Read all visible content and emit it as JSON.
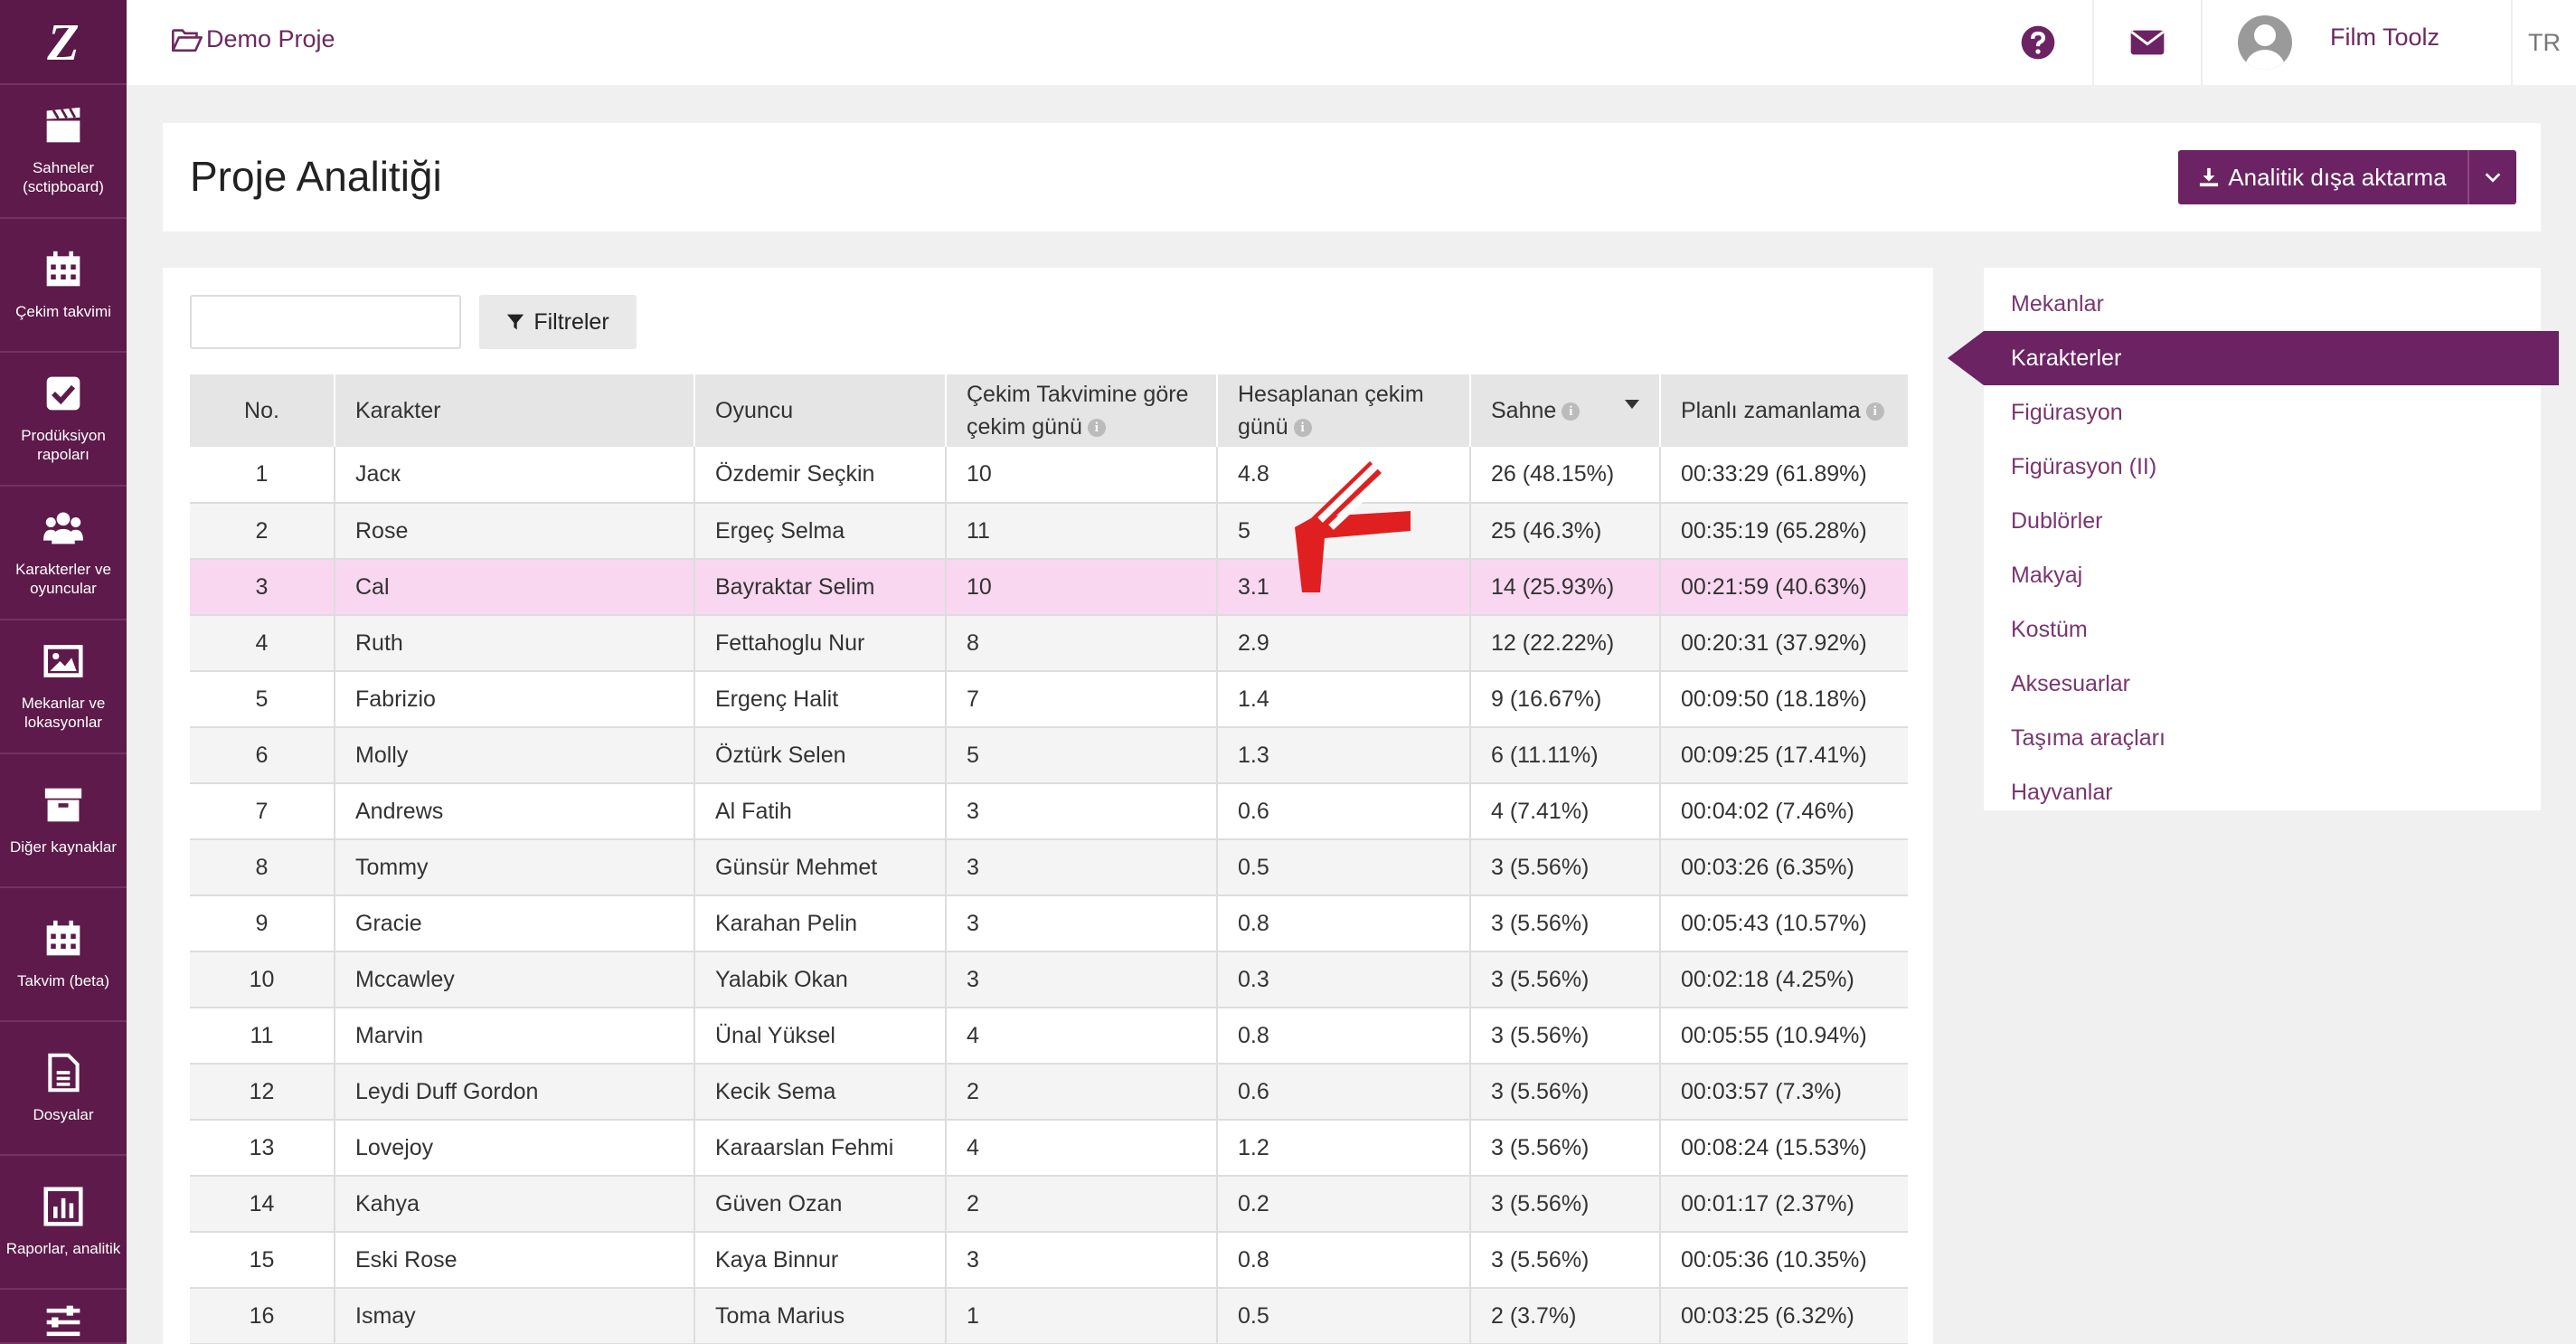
{
  "sidebar": {
    "logo": "Z",
    "items": [
      {
        "label": "Sahneler\n(sctipboard)",
        "icon": "clapperboard-icon"
      },
      {
        "label": "Çekim takvimi",
        "icon": "calendar-icon"
      },
      {
        "label": "Prodüksiyon\nrapoları",
        "icon": "checkbox-icon"
      },
      {
        "label": "Karakterler ve\noyuncular",
        "icon": "users-icon"
      },
      {
        "label": "Mekanlar ve\nlokasyonlar",
        "icon": "image-icon"
      },
      {
        "label": "Diğer kaynaklar",
        "icon": "archive-icon"
      },
      {
        "label": "Takvim (beta)",
        "icon": "calendar-beta-icon"
      },
      {
        "label": "Dosyalar",
        "icon": "file-icon"
      },
      {
        "label": "Raporlar, analitik",
        "icon": "chart-icon"
      }
    ]
  },
  "topbar": {
    "breadcrumb": "Demo Proje",
    "username": "Film Toolz",
    "language": "TR"
  },
  "header": {
    "title": "Proje Analitiği",
    "export_label": "Analitik dışa aktarma"
  },
  "toolbar": {
    "search_placeholder": "",
    "filter_label": "Filtreler"
  },
  "table": {
    "columns": [
      "No.",
      "Karakter",
      "Oyuncu",
      "Çekim Takvimine göre çekim günü",
      "Hesaplanan çekim günü",
      "Sahne",
      "Planlı zamanlama"
    ],
    "col3_line1": "Çekim Takvimine göre",
    "col3_line2": "çekim günü",
    "col4_line1": "Hesaplanan çekim",
    "col4_line2": "günü",
    "rows": [
      [
        "1",
        "Jacк",
        "Özdemir Seçkin",
        "10",
        "4.8",
        "26 (48.15%)",
        "00:33:29 (61.89%)"
      ],
      [
        "2",
        "Rose",
        "Ergeç Selma",
        "11",
        "5",
        "25 (46.3%)",
        "00:35:19 (65.28%)"
      ],
      [
        "3",
        "Cal",
        "Bayraktar Selim",
        "10",
        "3.1",
        "14 (25.93%)",
        "00:21:59 (40.63%)"
      ],
      [
        "4",
        "Ruth",
        "Fettahoglu Nur",
        "8",
        "2.9",
        "12 (22.22%)",
        "00:20:31 (37.92%)"
      ],
      [
        "5",
        "Fabrizio",
        "Ergenç Halit",
        "7",
        "1.4",
        "9 (16.67%)",
        "00:09:50 (18.18%)"
      ],
      [
        "6",
        "Molly",
        "Öztürk Selen",
        "5",
        "1.3",
        "6 (11.11%)",
        "00:09:25 (17.41%)"
      ],
      [
        "7",
        "Andrews",
        "Al Fatih",
        "3",
        "0.6",
        "4 (7.41%)",
        "00:04:02 (7.46%)"
      ],
      [
        "8",
        "Tommy",
        "Günsür Mehmet",
        "3",
        "0.5",
        "3 (5.56%)",
        "00:03:26 (6.35%)"
      ],
      [
        "9",
        "Gracie",
        "Karahan Pelin",
        "3",
        "0.8",
        "3 (5.56%)",
        "00:05:43 (10.57%)"
      ],
      [
        "10",
        "Mccawley",
        "Yalabik Okan",
        "3",
        "0.3",
        "3 (5.56%)",
        "00:02:18 (4.25%)"
      ],
      [
        "11",
        "Marvin",
        "Ünal Yüksel",
        "4",
        "0.8",
        "3 (5.56%)",
        "00:05:55 (10.94%)"
      ],
      [
        "12",
        "Leydi Duff Gordon",
        "Kecik Sema",
        "2",
        "0.6",
        "3 (5.56%)",
        "00:03:57 (7.3%)"
      ],
      [
        "13",
        "Lovejoy",
        "Karaarslan Fehmi",
        "4",
        "1.2",
        "3 (5.56%)",
        "00:08:24 (15.53%)"
      ],
      [
        "14",
        "Kahya",
        "Güven Ozan",
        "2",
        "0.2",
        "3 (5.56%)",
        "00:01:17 (2.37%)"
      ],
      [
        "15",
        "Eski Rose",
        "Kaya Binnur",
        "3",
        "0.8",
        "3 (5.56%)",
        "00:05:36 (10.35%)"
      ],
      [
        "16",
        "Ismay",
        "Toma Marius",
        "1",
        "0.5",
        "2 (3.7%)",
        "00:03:25 (6.32%)"
      ]
    ],
    "highlighted_row": 2
  },
  "right_nav": {
    "items": [
      "Mekanlar",
      "Karakterler",
      "Figürasyon",
      "Figürasyon (II)",
      "Dublörler",
      "Makyaj",
      "Kostüm",
      "Aksesuarlar",
      "Taşıma araçları",
      "Hayvanlar"
    ],
    "active": 1
  },
  "colors": {
    "brand": "#5d1a4a",
    "accent": "#6b2363",
    "highlight_row": "#f9d7f0",
    "annotation": "#e02020"
  }
}
